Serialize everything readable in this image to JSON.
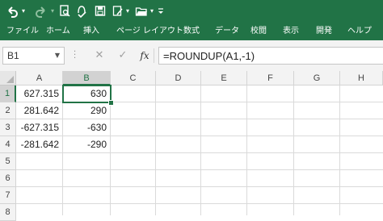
{
  "quick_access": {
    "undo_icon": "undo-icon",
    "redo_icon": "redo-icon",
    "print_preview_icon": "print-preview-icon",
    "spelling_icon": "spelling-check-icon",
    "save_icon": "save-icon",
    "format_icon": "format-icon",
    "open_icon": "open-folder-icon",
    "customize_icon": "customize-toolbar-icon"
  },
  "ribbon": {
    "tabs": [
      {
        "label": "ファイル"
      },
      {
        "label": "ホーム"
      },
      {
        "label": "挿入"
      },
      {
        "label": "ページ レイアウト"
      },
      {
        "label": "数式"
      },
      {
        "label": "データ"
      },
      {
        "label": "校閲"
      },
      {
        "label": "表示"
      },
      {
        "label": "開発"
      },
      {
        "label": "ヘルプ"
      }
    ]
  },
  "formula_bar": {
    "name_box": "B1",
    "cancel_symbol": "✕",
    "enter_symbol": "✓",
    "fx_label": "fx",
    "formula": "=ROUNDUP(A1,-1)"
  },
  "sheet": {
    "columns": [
      "A",
      "B",
      "C",
      "D",
      "E",
      "F",
      "G",
      "H"
    ],
    "selected_column": "B",
    "rows": [
      "1",
      "2",
      "3",
      "4",
      "5",
      "6",
      "7",
      "8"
    ],
    "selected_row": "1",
    "active_cell": "B1",
    "cells": [
      {
        "a": "627.315",
        "b": "630"
      },
      {
        "a": "281.642",
        "b": "290"
      },
      {
        "a": "-627.315",
        "b": "-630"
      },
      {
        "a": "-281.642",
        "b": "-290"
      }
    ]
  },
  "colors": {
    "accent": "#217346",
    "header_bg": "#f3f3f3",
    "selected_header_bg": "#d2d2d2",
    "gridline": "#dadada"
  }
}
